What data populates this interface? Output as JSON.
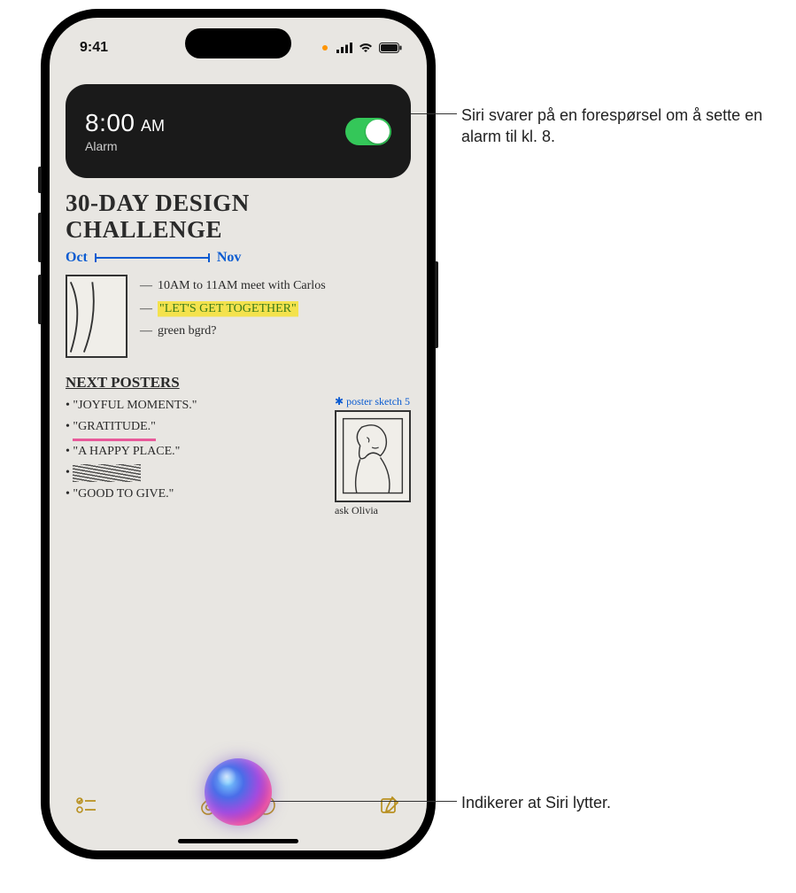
{
  "status": {
    "time": "9:41"
  },
  "alarm": {
    "time": "8:00",
    "ampm": "AM",
    "label": "Alarm",
    "enabled": true
  },
  "note": {
    "title_line1": "30-DAY DESIGN",
    "title_line2": "CHALLENGE",
    "timeline_start": "Oct",
    "timeline_end": "Nov",
    "bullets": [
      "10AM to 11AM meet with Carlos",
      "\"LET'S GET TOGETHER\"",
      "green bgrd?"
    ],
    "section_header": "NEXT POSTERS",
    "posters": [
      "\"JOYFUL MOMENTS.\"",
      "\"GRATITUDE.\"",
      "\"A HAPPY PLACE.\"",
      "scratched-out",
      "\"GOOD TO GIVE.\""
    ],
    "sketch2_label": "poster sketch 5",
    "ask_label": "ask Olivia"
  },
  "callouts": {
    "top": "Siri svarer på en forespørsel om å sette en alarm til kl. 8.",
    "bottom": "Indikerer at Siri lytter."
  }
}
